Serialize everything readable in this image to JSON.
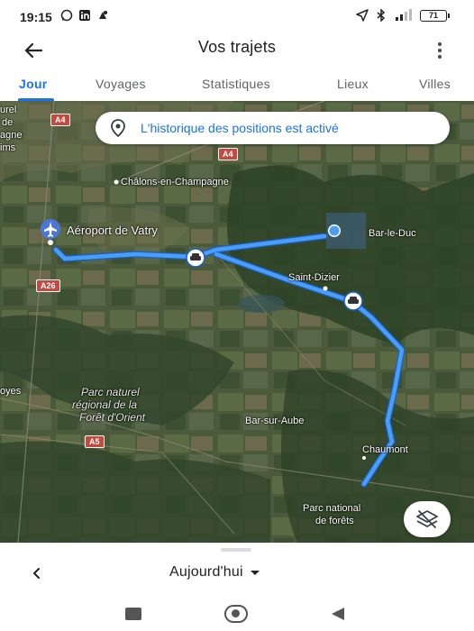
{
  "status_bar": {
    "time": "19:15",
    "left_icons": [
      "whatsapp-icon",
      "linkedin-icon",
      "notification-icon"
    ],
    "right_icons": [
      "location-arrow-icon",
      "bluetooth-icon",
      "signal-icon"
    ],
    "battery": "71"
  },
  "app_bar": {
    "title": "Vos trajets",
    "back_icon": "arrow-left-icon",
    "menu_icon": "more-vert-icon"
  },
  "tabs": [
    {
      "label": "Jour",
      "active": true
    },
    {
      "label": "Voyages",
      "active": false
    },
    {
      "label": "Statistiques",
      "active": false
    },
    {
      "label": "Lieux",
      "active": false
    },
    {
      "label": "Villes",
      "active": false
    }
  ],
  "map": {
    "history_banner": "L'historique des positions est activé",
    "labels": {
      "chalons": "Châlons-en-Champagne",
      "vatry": "Aéroport de Vatry",
      "bar_le_duc": "Bar-le-Duc",
      "saint_dizier": "Saint-Dizier",
      "parc_orient_1": "Parc naturel",
      "parc_orient_2": "régional de la",
      "parc_orient_3": "Forêt d'Orient",
      "bar_sur_aube": "Bar-sur-Aube",
      "chaumont": "Chaumont",
      "parc_forets_1": "Parc national",
      "parc_forets_2": "de forêts",
      "edge_troyes": "oyes",
      "edge_top_1": "urel",
      "edge_top_2": "de",
      "edge_top_3": "agne",
      "edge_top_4": "ims"
    },
    "road_shields": {
      "a4_top": "A4",
      "a4_mid": "A4",
      "a26": "A26",
      "a5": "A5"
    },
    "route_color": "#4a9df8",
    "layers_icon": "layers-off-icon"
  },
  "bottom_sheet": {
    "date": "Aujourd'hui",
    "prev_icon": "chevron-left-icon",
    "dropdown_icon": "caret-down-icon"
  },
  "nav_bar": {
    "recent_icon": "recent-apps-icon",
    "home_icon": "home-icon",
    "back_icon": "back-triangle-icon"
  }
}
